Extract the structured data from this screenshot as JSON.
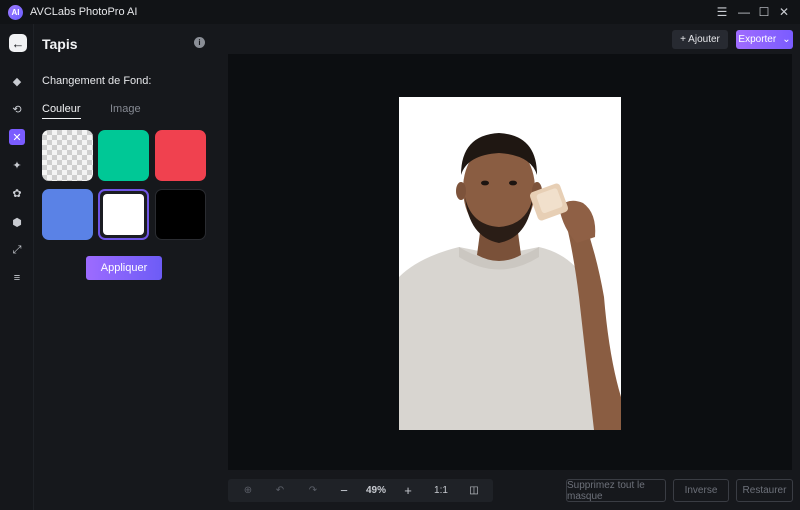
{
  "app": {
    "title": "AVCLabs PhotoPro AI",
    "logo_text": "AI"
  },
  "window_controls": [
    {
      "name": "menu-icon",
      "glyph": "☰"
    },
    {
      "name": "minimize-icon",
      "glyph": "—"
    },
    {
      "name": "maximize-icon",
      "glyph": "☐"
    },
    {
      "name": "close-icon",
      "glyph": "✕"
    }
  ],
  "rail": {
    "back_glyph": "←",
    "items": [
      {
        "name": "eraser-icon",
        "glyph": "◆"
      },
      {
        "name": "object-removal-icon",
        "glyph": "⟲"
      },
      {
        "name": "background-icon",
        "glyph": "✕",
        "active": true
      },
      {
        "name": "enhance-icon",
        "glyph": "✦"
      },
      {
        "name": "retouch-icon",
        "glyph": "✿"
      },
      {
        "name": "colorize-icon",
        "glyph": "⬢"
      },
      {
        "name": "resize-icon",
        "glyph": "⤢"
      },
      {
        "name": "adjust-icon",
        "glyph": "≡"
      }
    ]
  },
  "panel": {
    "title": "Tapis",
    "info_glyph": "i",
    "section_label": "Changement de Fond:",
    "tabs": [
      {
        "label": "Couleur",
        "active": true
      },
      {
        "label": "Image",
        "active": false
      }
    ],
    "swatches": [
      {
        "name": "transparent",
        "color": "transparent"
      },
      {
        "name": "green",
        "color": "#00c896"
      },
      {
        "name": "red",
        "color": "#f0414f"
      },
      {
        "name": "blue",
        "color": "#5a82e6"
      },
      {
        "name": "white",
        "color": "#ffffff",
        "selected": true
      },
      {
        "name": "black",
        "color": "#000000"
      }
    ],
    "apply_label": "Appliquer"
  },
  "topbar": {
    "add_label": "+ Ajouter",
    "export_label": "Exporter",
    "export_chevron": "⌄"
  },
  "toolbar": {
    "compare_glyph": "⊕",
    "undo_glyph": "↶",
    "redo_glyph": "↷",
    "zoom_out_glyph": "−",
    "zoom_level": "49%",
    "zoom_in_glyph": "+",
    "actual_size": "1:1",
    "split_glyph": "◫"
  },
  "actions": {
    "remove_mask": "Supprimez tout le masque",
    "invert": "Inverse",
    "restore": "Restaurer"
  },
  "colors": {
    "accent": "#7a5cff",
    "background": "#16181c",
    "canvas": "#0c0e11"
  }
}
